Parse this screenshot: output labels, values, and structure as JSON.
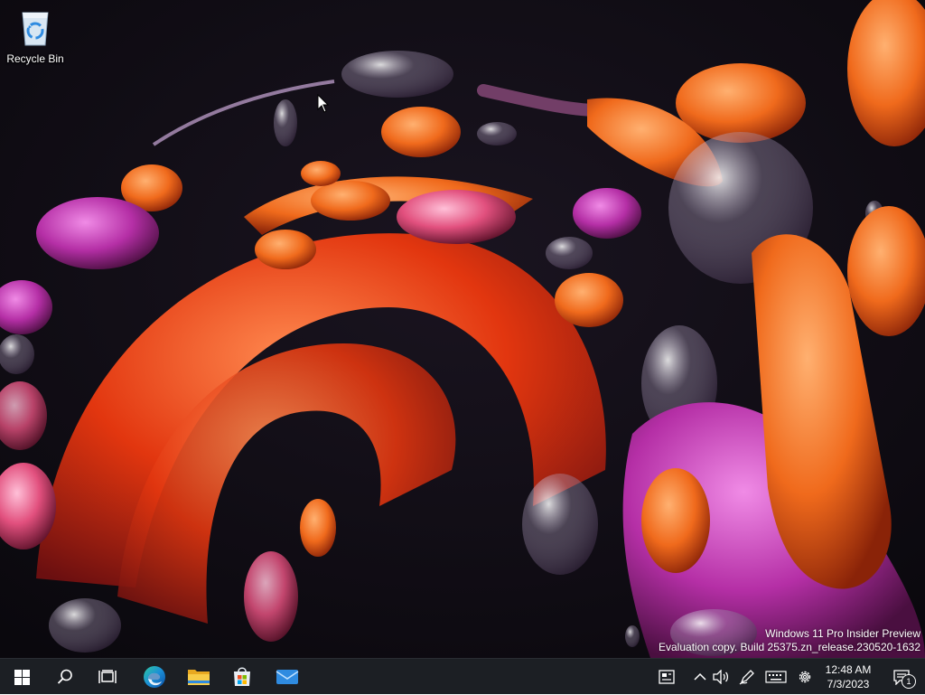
{
  "desktop": {
    "icons": [
      {
        "label": "Recycle Bin",
        "icon": "recycle-bin-icon"
      }
    ],
    "watermark": {
      "line1": "Windows 11 Pro Insider Preview",
      "line2": "Evaluation copy. Build 25375.zn_release.230520-1632"
    }
  },
  "taskbar": {
    "pinned": [
      {
        "name": "start",
        "icon": "windows-logo-icon"
      },
      {
        "name": "search",
        "icon": "search-icon"
      },
      {
        "name": "task-view",
        "icon": "task-view-icon"
      },
      {
        "name": "edge",
        "icon": "edge-icon"
      },
      {
        "name": "file-explorer",
        "icon": "folder-icon"
      },
      {
        "name": "microsoft-store",
        "icon": "store-icon"
      },
      {
        "name": "mail",
        "icon": "mail-icon"
      }
    ],
    "tray": {
      "icons": [
        "news-icon",
        "chevron-up-icon",
        "volume-icon",
        "pen-icon",
        "keyboard-icon",
        "gear-icon"
      ],
      "time": "12:48 AM",
      "date": "7/3/2023",
      "notification_count": "1"
    }
  },
  "colors": {
    "taskbar_bg": "#1c1f24",
    "desktop_bg": "#0f0b14",
    "accent_blue": "#3aa0ff"
  }
}
